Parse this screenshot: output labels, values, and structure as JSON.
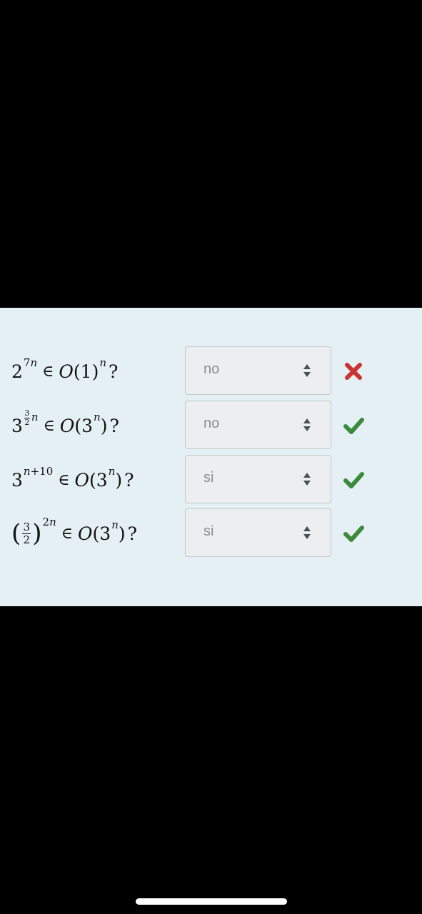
{
  "questions": [
    {
      "options": {
        "selected": "no"
      },
      "result": "incorrect"
    },
    {
      "options": {
        "selected": "no"
      },
      "result": "correct"
    },
    {
      "options": {
        "selected": "si"
      },
      "result": "correct"
    },
    {
      "options": {
        "selected": "si"
      },
      "result": "correct"
    }
  ],
  "colors": {
    "panel_bg": "#e5f0f4",
    "correct": "#3c8a3c",
    "incorrect": "#cc3333",
    "select_bg": "#eceeef",
    "select_text": "#8a8f93"
  },
  "icons": {
    "select_arrows": "up-down-arrows-icon",
    "correct": "check-icon",
    "incorrect": "cross-icon"
  }
}
